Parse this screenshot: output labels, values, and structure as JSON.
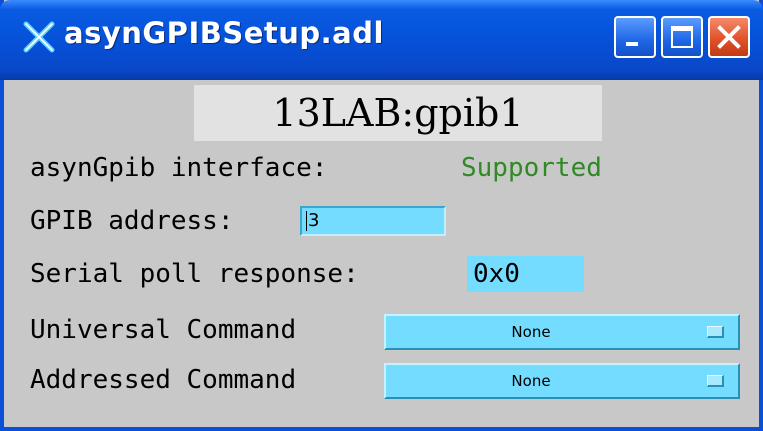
{
  "window": {
    "title": "asynGPIBSetup.adl",
    "icon": "x-app-icon",
    "controls": [
      "minimize-icon",
      "maximize-icon",
      "close-icon"
    ]
  },
  "pv_name": "13LAB:gpib1",
  "interface": {
    "label": "asynGpib interface:",
    "value": "Supported",
    "value_color": "#2f8a24"
  },
  "address": {
    "label": "GPIB address:",
    "value": "3"
  },
  "serial_poll": {
    "label": "Serial poll response:",
    "value": "0x0"
  },
  "universal_command": {
    "label": "Universal Command",
    "selected": "None"
  },
  "addressed_command": {
    "label": "Addressed Command",
    "selected": "None"
  },
  "colors": {
    "field_bg": "#73dcff",
    "panel_bg": "#c8c8c8",
    "title_bar": "#0551d8"
  }
}
